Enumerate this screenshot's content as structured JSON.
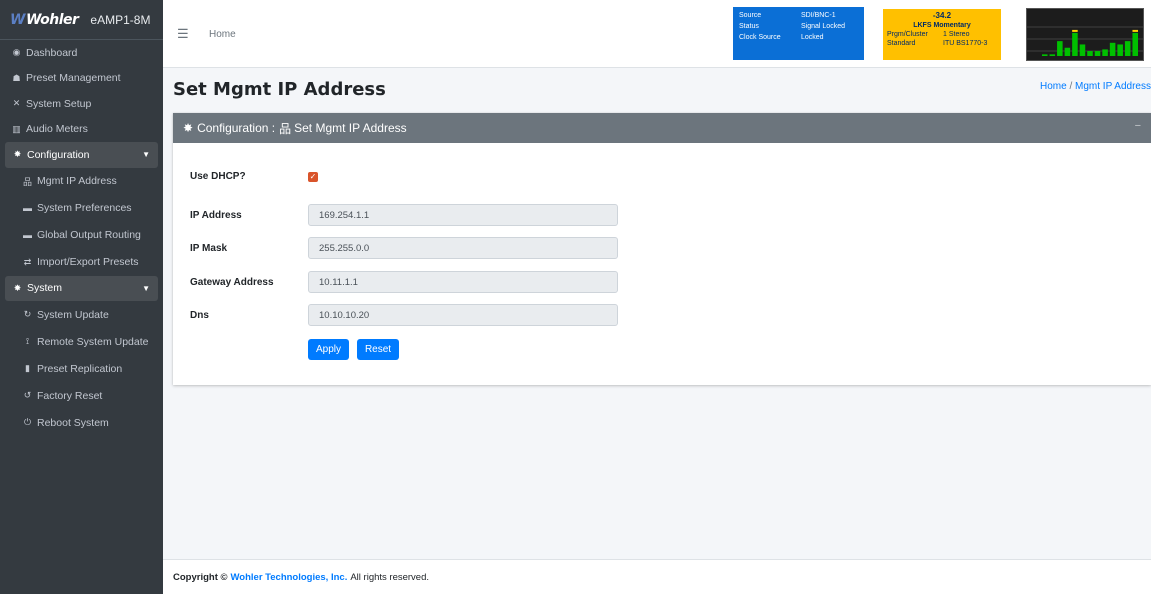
{
  "brand": {
    "logo_text": "Wohler",
    "product": "eAMP1-8M"
  },
  "sidebar": {
    "items": [
      {
        "icon": "dashboard-icon",
        "glyph": "◉",
        "label": "Dashboard"
      },
      {
        "icon": "preset-management-icon",
        "glyph": "☗",
        "label": "Preset Management"
      },
      {
        "icon": "tools-icon",
        "glyph": "✕",
        "label": "System Setup"
      },
      {
        "icon": "chart-icon",
        "glyph": "▥",
        "label": "Audio Meters"
      },
      {
        "icon": "gear-icon",
        "glyph": "✸",
        "label": "Configuration",
        "open": true
      },
      {
        "icon": "network-icon",
        "glyph": "品",
        "label": "Mgmt IP Address",
        "sub": true
      },
      {
        "icon": "keyboard-icon",
        "glyph": "▬",
        "label": "System Preferences",
        "sub": true
      },
      {
        "icon": "keyboard-icon",
        "glyph": "▬",
        "label": "Global Output Routing",
        "sub": true
      },
      {
        "icon": "exchange-icon",
        "glyph": "⇄",
        "label": "Import/Export Presets",
        "sub": true
      },
      {
        "icon": "gears-icon",
        "glyph": "✸",
        "label": "System",
        "open": true
      },
      {
        "icon": "sync-icon",
        "glyph": "↻",
        "label": "System Update",
        "sub": true
      },
      {
        "icon": "satellite-icon",
        "glyph": "⟟",
        "label": "Remote System Update",
        "sub": true
      },
      {
        "icon": "copy-icon",
        "glyph": "▮",
        "label": "Preset Replication",
        "sub": true
      },
      {
        "icon": "undo-icon",
        "glyph": "↺",
        "label": "Factory Reset",
        "sub": true
      },
      {
        "icon": "power-icon",
        "glyph": "⏻",
        "label": "Reboot System",
        "sub": true
      }
    ]
  },
  "header": {
    "home_label": "Home",
    "status": [
      {
        "key": "Source",
        "value": "SDI/BNC-1"
      },
      {
        "key": "Status",
        "value": "Signal Locked"
      },
      {
        "key": "Clock Source",
        "value": "Locked"
      }
    ],
    "loudness": {
      "value": "-34.2",
      "mode": "LKFS  Momentary",
      "prgm_key": "Prgm/Cluster",
      "prgm_value": "1  Stereo",
      "standard_key": "Standard",
      "standard_value": "ITU BS1770-3"
    },
    "meter_levels": [
      0.05,
      0.05,
      0.45,
      0.25,
      0.7,
      0.35,
      0.15,
      0.15,
      0.2,
      0.4,
      0.35,
      0.45,
      0.7
    ],
    "meter_colors": {
      "bar": "#00c000",
      "peak": "#ffd200",
      "bg": "#1c1c1c"
    }
  },
  "page": {
    "title": "Set Mgmt IP Address",
    "breadcrumb_home": "Home",
    "breadcrumb_sep": "/",
    "breadcrumb_current": "Mgmt IP Address"
  },
  "card": {
    "title_prefix": "Configuration :",
    "title": "Set Mgmt IP Address",
    "collapse_glyph": "−"
  },
  "form": {
    "dhcp_label": "Use DHCP?",
    "dhcp_checked": true,
    "ip_label": "IP Address",
    "ip_value": "169.254.1.1",
    "mask_label": "IP Mask",
    "mask_value": "255.255.0.0",
    "gateway_label": "Gateway Address",
    "gateway_value": "10.11.1.1",
    "dns_label": "Dns",
    "dns_value": "10.10.10.20",
    "apply_label": "Apply",
    "reset_label": "Reset"
  },
  "footer": {
    "copyright_prefix": "Copyright ©",
    "company": "Wohler Technologies, Inc.",
    "suffix": "All rights reserved."
  },
  "colors": {
    "accent": "#007bff",
    "sidebar": "#343a40",
    "status_blue": "#0b6fd6",
    "loudness_yellow": "#ffc000",
    "card_header": "#6c757d",
    "checkbox": "#d9542b"
  }
}
